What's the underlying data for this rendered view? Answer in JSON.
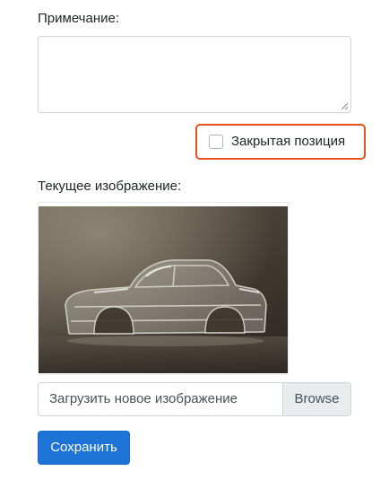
{
  "note": {
    "label": "Примечание:",
    "value": ""
  },
  "closed_position": {
    "label": "Закрытая позиция",
    "checked": false,
    "highlight_color": "#e8501e"
  },
  "current_image": {
    "label": "Текущее изображение:"
  },
  "upload": {
    "placeholder": "Загрузить новое изображение",
    "browse_label": "Browse"
  },
  "save_button": {
    "label": "Сохранить",
    "color": "#1e73d6"
  },
  "icons": {
    "resize": "resize-grip-icon",
    "image": "car-body-photo"
  }
}
